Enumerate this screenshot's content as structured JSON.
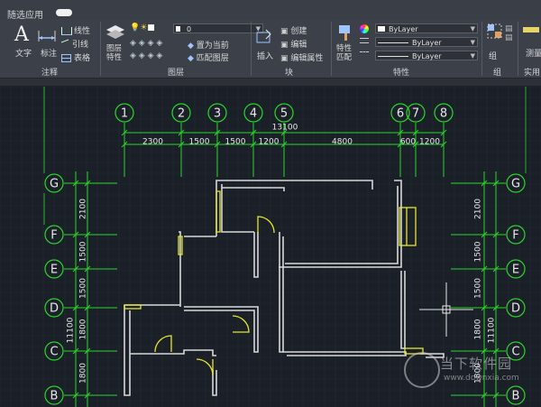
{
  "quick_access": {
    "title": "随选应用"
  },
  "ribbon": {
    "annotate": {
      "title": "注释",
      "text_label": "文字",
      "dim_label": "标注",
      "linear_label": "线性",
      "leader_label": "引线",
      "table_label": "表格"
    },
    "layers": {
      "title": "图层",
      "props_label": "图层\n特性",
      "current_layer": "0",
      "set_current_label": "置为当前",
      "match_label": "匹配图层"
    },
    "block": {
      "title": "块",
      "insert_label": "插入",
      "create_label": "创建",
      "edit_label": "编辑",
      "edit_attr_label": "编辑属性"
    },
    "properties": {
      "title": "特性",
      "match_label": "特性\n匹配",
      "color": "ByLayer",
      "linetype": "ByLayer",
      "lineweight": "ByLayer"
    },
    "groups": {
      "title": "组",
      "group_label": "组"
    },
    "utilities": {
      "title": "实用",
      "measure_label": "测量"
    }
  },
  "drawing": {
    "top_axes": [
      "1",
      "2",
      "3",
      "4",
      "5",
      "6",
      "7",
      "8"
    ],
    "side_axes": [
      "G",
      "F",
      "E",
      "D",
      "C",
      "B"
    ],
    "top_total": "13100",
    "top_dims": [
      "2300",
      "1500",
      "1500",
      "1200",
      "4800",
      "600",
      "1200"
    ],
    "left_dims": [
      "2100",
      "1500",
      "1500",
      "1800",
      "1800"
    ],
    "left_total": "11100",
    "right_dims": [
      "2100",
      "1500",
      "1500",
      "1800",
      "1800"
    ],
    "right_total": "11100"
  },
  "watermark": {
    "name": "当下软件园",
    "url": "www.downxia.com"
  },
  "colors": {
    "axis": "#2ad62a",
    "wall": "#d8d8d8",
    "door": "#e6e62a",
    "canvas": "#1b2028"
  }
}
